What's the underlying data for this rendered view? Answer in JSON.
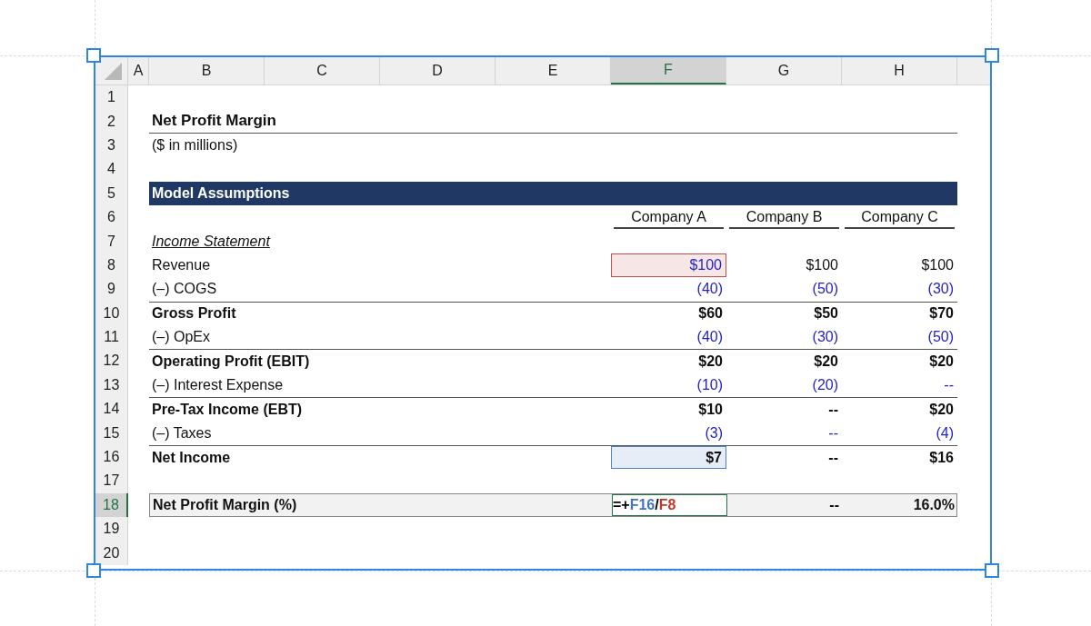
{
  "columns": [
    {
      "label": "A",
      "selected": false
    },
    {
      "label": "B",
      "selected": false
    },
    {
      "label": "C",
      "selected": false
    },
    {
      "label": "D",
      "selected": false
    },
    {
      "label": "E",
      "selected": false
    },
    {
      "label": "F",
      "selected": true
    },
    {
      "label": "G",
      "selected": false
    },
    {
      "label": "H",
      "selected": false
    }
  ],
  "rows": [
    {
      "number": "1",
      "selected": false,
      "kind": "blank"
    },
    {
      "number": "2",
      "selected": false,
      "kind": "title",
      "label": "Net Profit Margin"
    },
    {
      "number": "3",
      "selected": false,
      "kind": "subtitle",
      "label": "($ in millions)"
    },
    {
      "number": "4",
      "selected": false,
      "kind": "blank"
    },
    {
      "number": "5",
      "selected": false,
      "kind": "section",
      "label": "Model Assumptions"
    },
    {
      "number": "6",
      "selected": false,
      "kind": "headers",
      "values": [
        "Company A",
        "Company B",
        "Company C"
      ]
    },
    {
      "number": "7",
      "selected": false,
      "kind": "category",
      "label": "Income Statement"
    },
    {
      "number": "8",
      "selected": false,
      "kind": "item",
      "label": "Revenue",
      "values": [
        {
          "text": "$100",
          "input": true,
          "color": "#c0504d"
        },
        {
          "text": "$100",
          "input": false
        },
        {
          "text": "$100",
          "input": false
        }
      ]
    },
    {
      "number": "9",
      "selected": false,
      "kind": "item",
      "label": "(–) COGS",
      "values": [
        {
          "text": "(40)",
          "input": true
        },
        {
          "text": "(50)",
          "input": true
        },
        {
          "text": "(30)",
          "input": true
        }
      ]
    },
    {
      "number": "10",
      "selected": false,
      "kind": "total",
      "label": "Gross Profit",
      "values": [
        {
          "text": "$60",
          "input": false
        },
        {
          "text": "$50",
          "input": false
        },
        {
          "text": "$70",
          "input": false
        }
      ]
    },
    {
      "number": "11",
      "selected": false,
      "kind": "item",
      "label": "(–) OpEx",
      "values": [
        {
          "text": "(40)",
          "input": true
        },
        {
          "text": "(30)",
          "input": true
        },
        {
          "text": "(50)",
          "input": true
        }
      ]
    },
    {
      "number": "12",
      "selected": false,
      "kind": "total",
      "label": "Operating Profit (EBIT)",
      "values": [
        {
          "text": "$20",
          "input": false
        },
        {
          "text": "$20",
          "input": false
        },
        {
          "text": "$20",
          "input": false
        }
      ]
    },
    {
      "number": "13",
      "selected": false,
      "kind": "item",
      "label": "(–) Interest Expense",
      "values": [
        {
          "text": "(10)",
          "input": true
        },
        {
          "text": "(20)",
          "input": true
        },
        {
          "text": "--",
          "input": true
        }
      ]
    },
    {
      "number": "14",
      "selected": false,
      "kind": "total",
      "label": "Pre-Tax Income (EBT)",
      "values": [
        {
          "text": "$10",
          "input": false
        },
        {
          "text": "--",
          "input": false
        },
        {
          "text": "$20",
          "input": false
        }
      ]
    },
    {
      "number": "15",
      "selected": false,
      "kind": "item",
      "label": "(–) Taxes",
      "values": [
        {
          "text": "(3)",
          "input": true
        },
        {
          "text": "--",
          "input": true
        },
        {
          "text": "(4)",
          "input": true
        }
      ]
    },
    {
      "number": "16",
      "selected": false,
      "kind": "total",
      "label": "Net Income",
      "values": [
        {
          "text": "$7",
          "input": false,
          "color": "#4f81bd"
        },
        {
          "text": "--",
          "input": false
        },
        {
          "text": "$16",
          "input": false
        }
      ]
    },
    {
      "number": "17",
      "selected": false,
      "kind": "blank"
    },
    {
      "number": "18",
      "selected": true,
      "kind": "result",
      "label": "Net Profit Margin (%)",
      "values": [
        {
          "kind": "formula",
          "editing": true,
          "parts": [
            {
              "text": "=+",
              "color": "#000000"
            },
            {
              "text": "F16",
              "color": "#4472c4"
            },
            {
              "text": "/",
              "color": "#000000"
            },
            {
              "text": "F8",
              "color": "#c0392b"
            }
          ]
        },
        {
          "kind": "text",
          "text": "--",
          "input": false
        },
        {
          "kind": "text",
          "text": "16.0%",
          "input": false
        }
      ]
    },
    {
      "number": "19",
      "selected": false,
      "kind": "blank"
    },
    {
      "number": "20",
      "selected": false,
      "kind": "blank"
    }
  ]
}
